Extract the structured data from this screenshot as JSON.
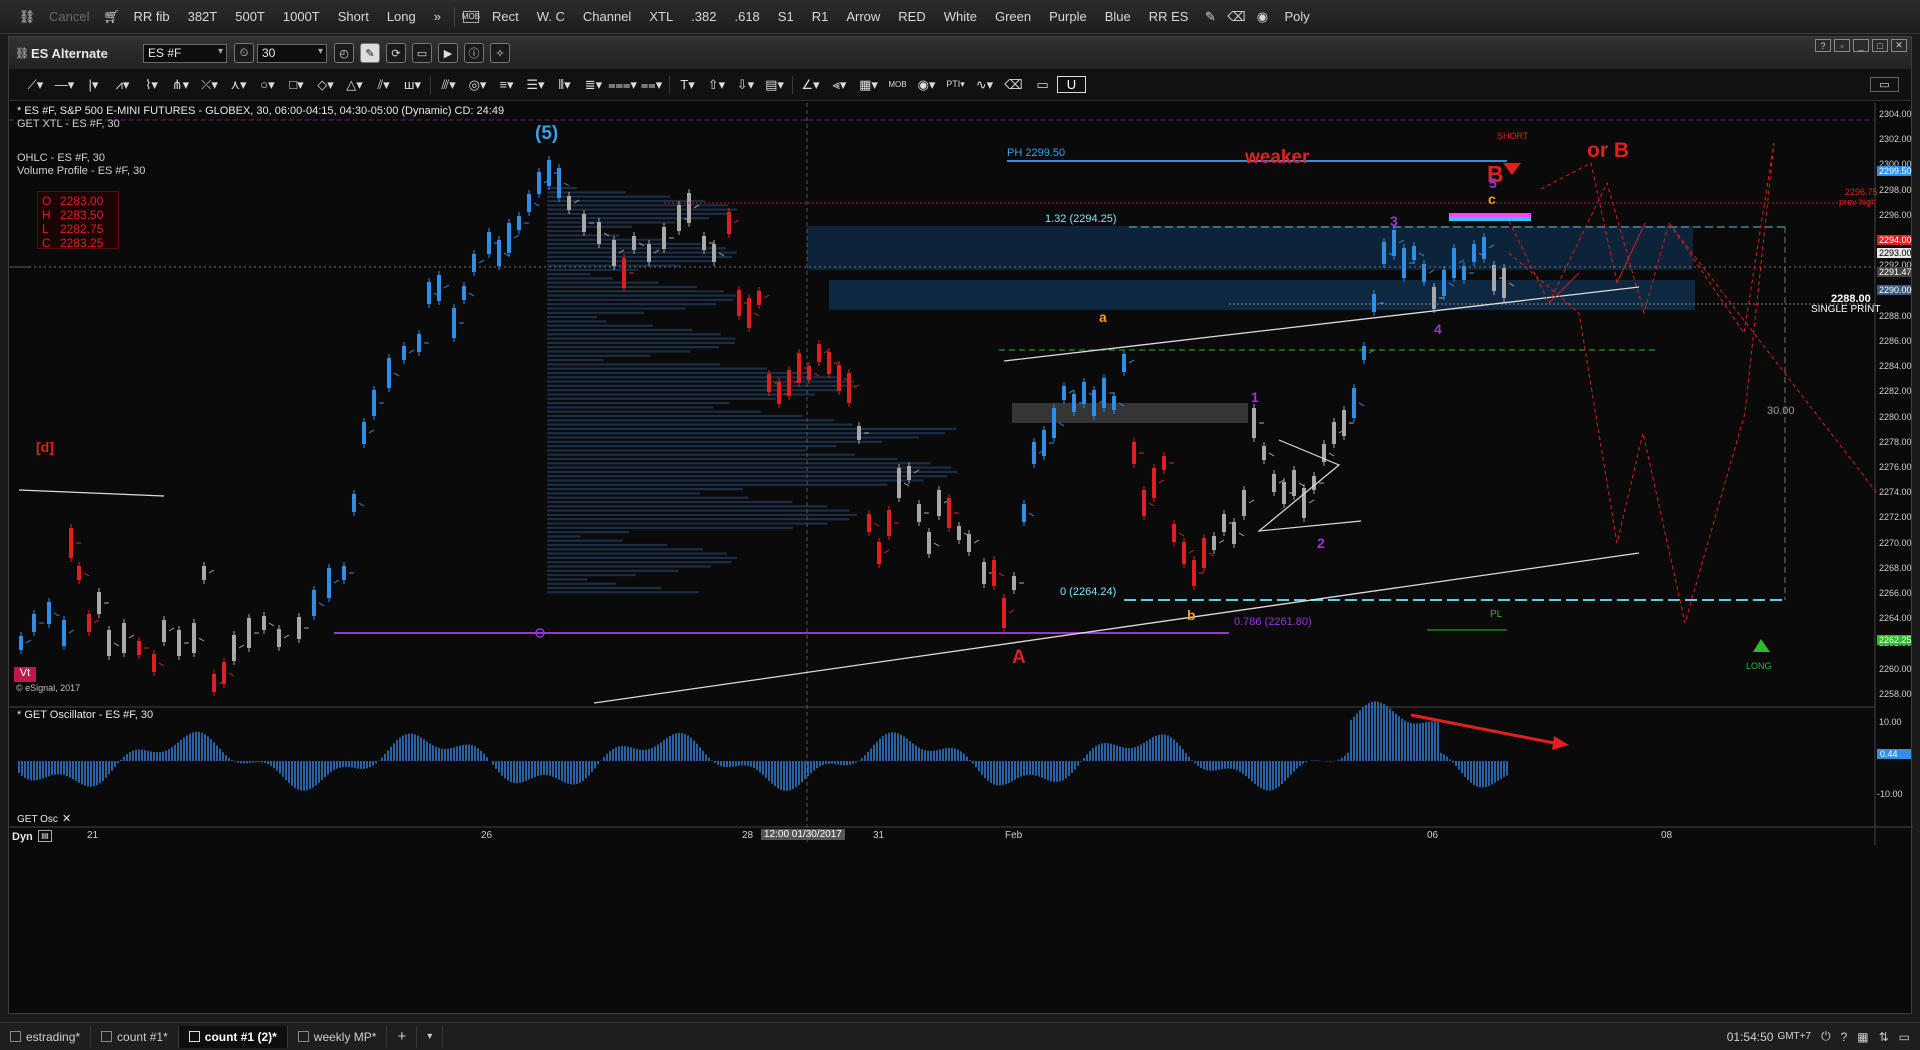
{
  "toolbar": {
    "cancel": "Cancel",
    "items": [
      "RR fib",
      "382T",
      "500T",
      "1000T",
      "Short",
      "Long",
      "»"
    ],
    "draw_items": [
      "Rect",
      "W. C",
      "Channel",
      "XTL",
      ".382",
      ".618",
      "S1",
      "R1",
      "Arrow",
      "RED",
      "White",
      "Green",
      "Purple",
      "Blue",
      "RR ES",
      "Poly"
    ]
  },
  "window": {
    "title": "ES Alternate",
    "symbol": "ES #F",
    "interval": "30"
  },
  "chart": {
    "header": "* ES #F, S&P 500 E-MINI FUTURES - GLOBEX, 30, 06:00-04:15, 04:30-05:00 (Dynamic) CD: 24:49",
    "study1": "GET XTL - ES #F, 30",
    "study2": "OHLC - ES #F, 30",
    "study3": "Volume Profile - ES #F, 30",
    "ohlc": {
      "o_label": "O",
      "o": "2283.00",
      "h_label": "H",
      "h": "2283.50",
      "l_label": "L",
      "l": "2282.75",
      "c_label": "C",
      "c": "2283.25"
    },
    "annotations": {
      "wave5": "(5)",
      "weaker": "weaker",
      "or_b": "or B",
      "b_big": "B",
      "short": "SHORT",
      "long": "LONG",
      "a_big": "A",
      "a_small": "a",
      "b_small": "b",
      "c_small": "c",
      "n1": "1",
      "n2": "2",
      "n3": "3",
      "n4": "4",
      "n5": "5",
      "d_bracket": "[d]",
      "ph": "PH 2299.50",
      "fib132": "1.32 (2294.25)",
      "fib0": "0 (2264.24)",
      "fib786": "0.786 (2261.80)",
      "single_print_price": "2288.00",
      "single_print": "SINGLE PRINT",
      "prev_high_price": "2296.75",
      "prev_high": "prev high",
      "measure": "30.00",
      "pl": "PL",
      "vt": "Vt",
      "esignal": "© eSignal, 2017",
      "p": "P"
    },
    "price_axis": [
      "2304.00",
      "2302.00",
      "2300.00",
      "2298.00",
      "2296.00",
      "2294.00",
      "2292.00",
      "2290.00",
      "2288.00",
      "2286.00",
      "2284.00",
      "2282.00",
      "2280.00",
      "2278.00",
      "2276.00",
      "2274.00",
      "2272.00",
      "2270.00",
      "2268.00",
      "2266.00",
      "2264.00",
      "2262.00",
      "2260.00",
      "2258.00"
    ],
    "price_tags": {
      "t1": "2299.50",
      "t2": "2294.00",
      "t3": "2293.00",
      "t4": "2291.47",
      "t5": "2290.00",
      "t6": "2262.25"
    },
    "oscillator_title": "* GET Oscillator - ES #F, 30",
    "osc_axis": [
      "10.00",
      "-10.00"
    ],
    "osc_value": "0.44",
    "osc_panel_label": "GET Osc",
    "time_axis": [
      "21",
      "26",
      "28",
      "31",
      "Feb",
      "06",
      "08"
    ],
    "cursor_time": "12:00 01/30/2017",
    "dyn": "Dyn"
  },
  "tabs": [
    "estrading*",
    "count #1*",
    "count #1 (2)*",
    "weekly MP*"
  ],
  "status": {
    "clock": "01:54:50",
    "tz": "GMT+7"
  },
  "colors": {
    "bull": "#2f8fe6",
    "bear": "#e02020",
    "neutral": "#a8a8a8",
    "background": "#0a0a0a"
  }
}
